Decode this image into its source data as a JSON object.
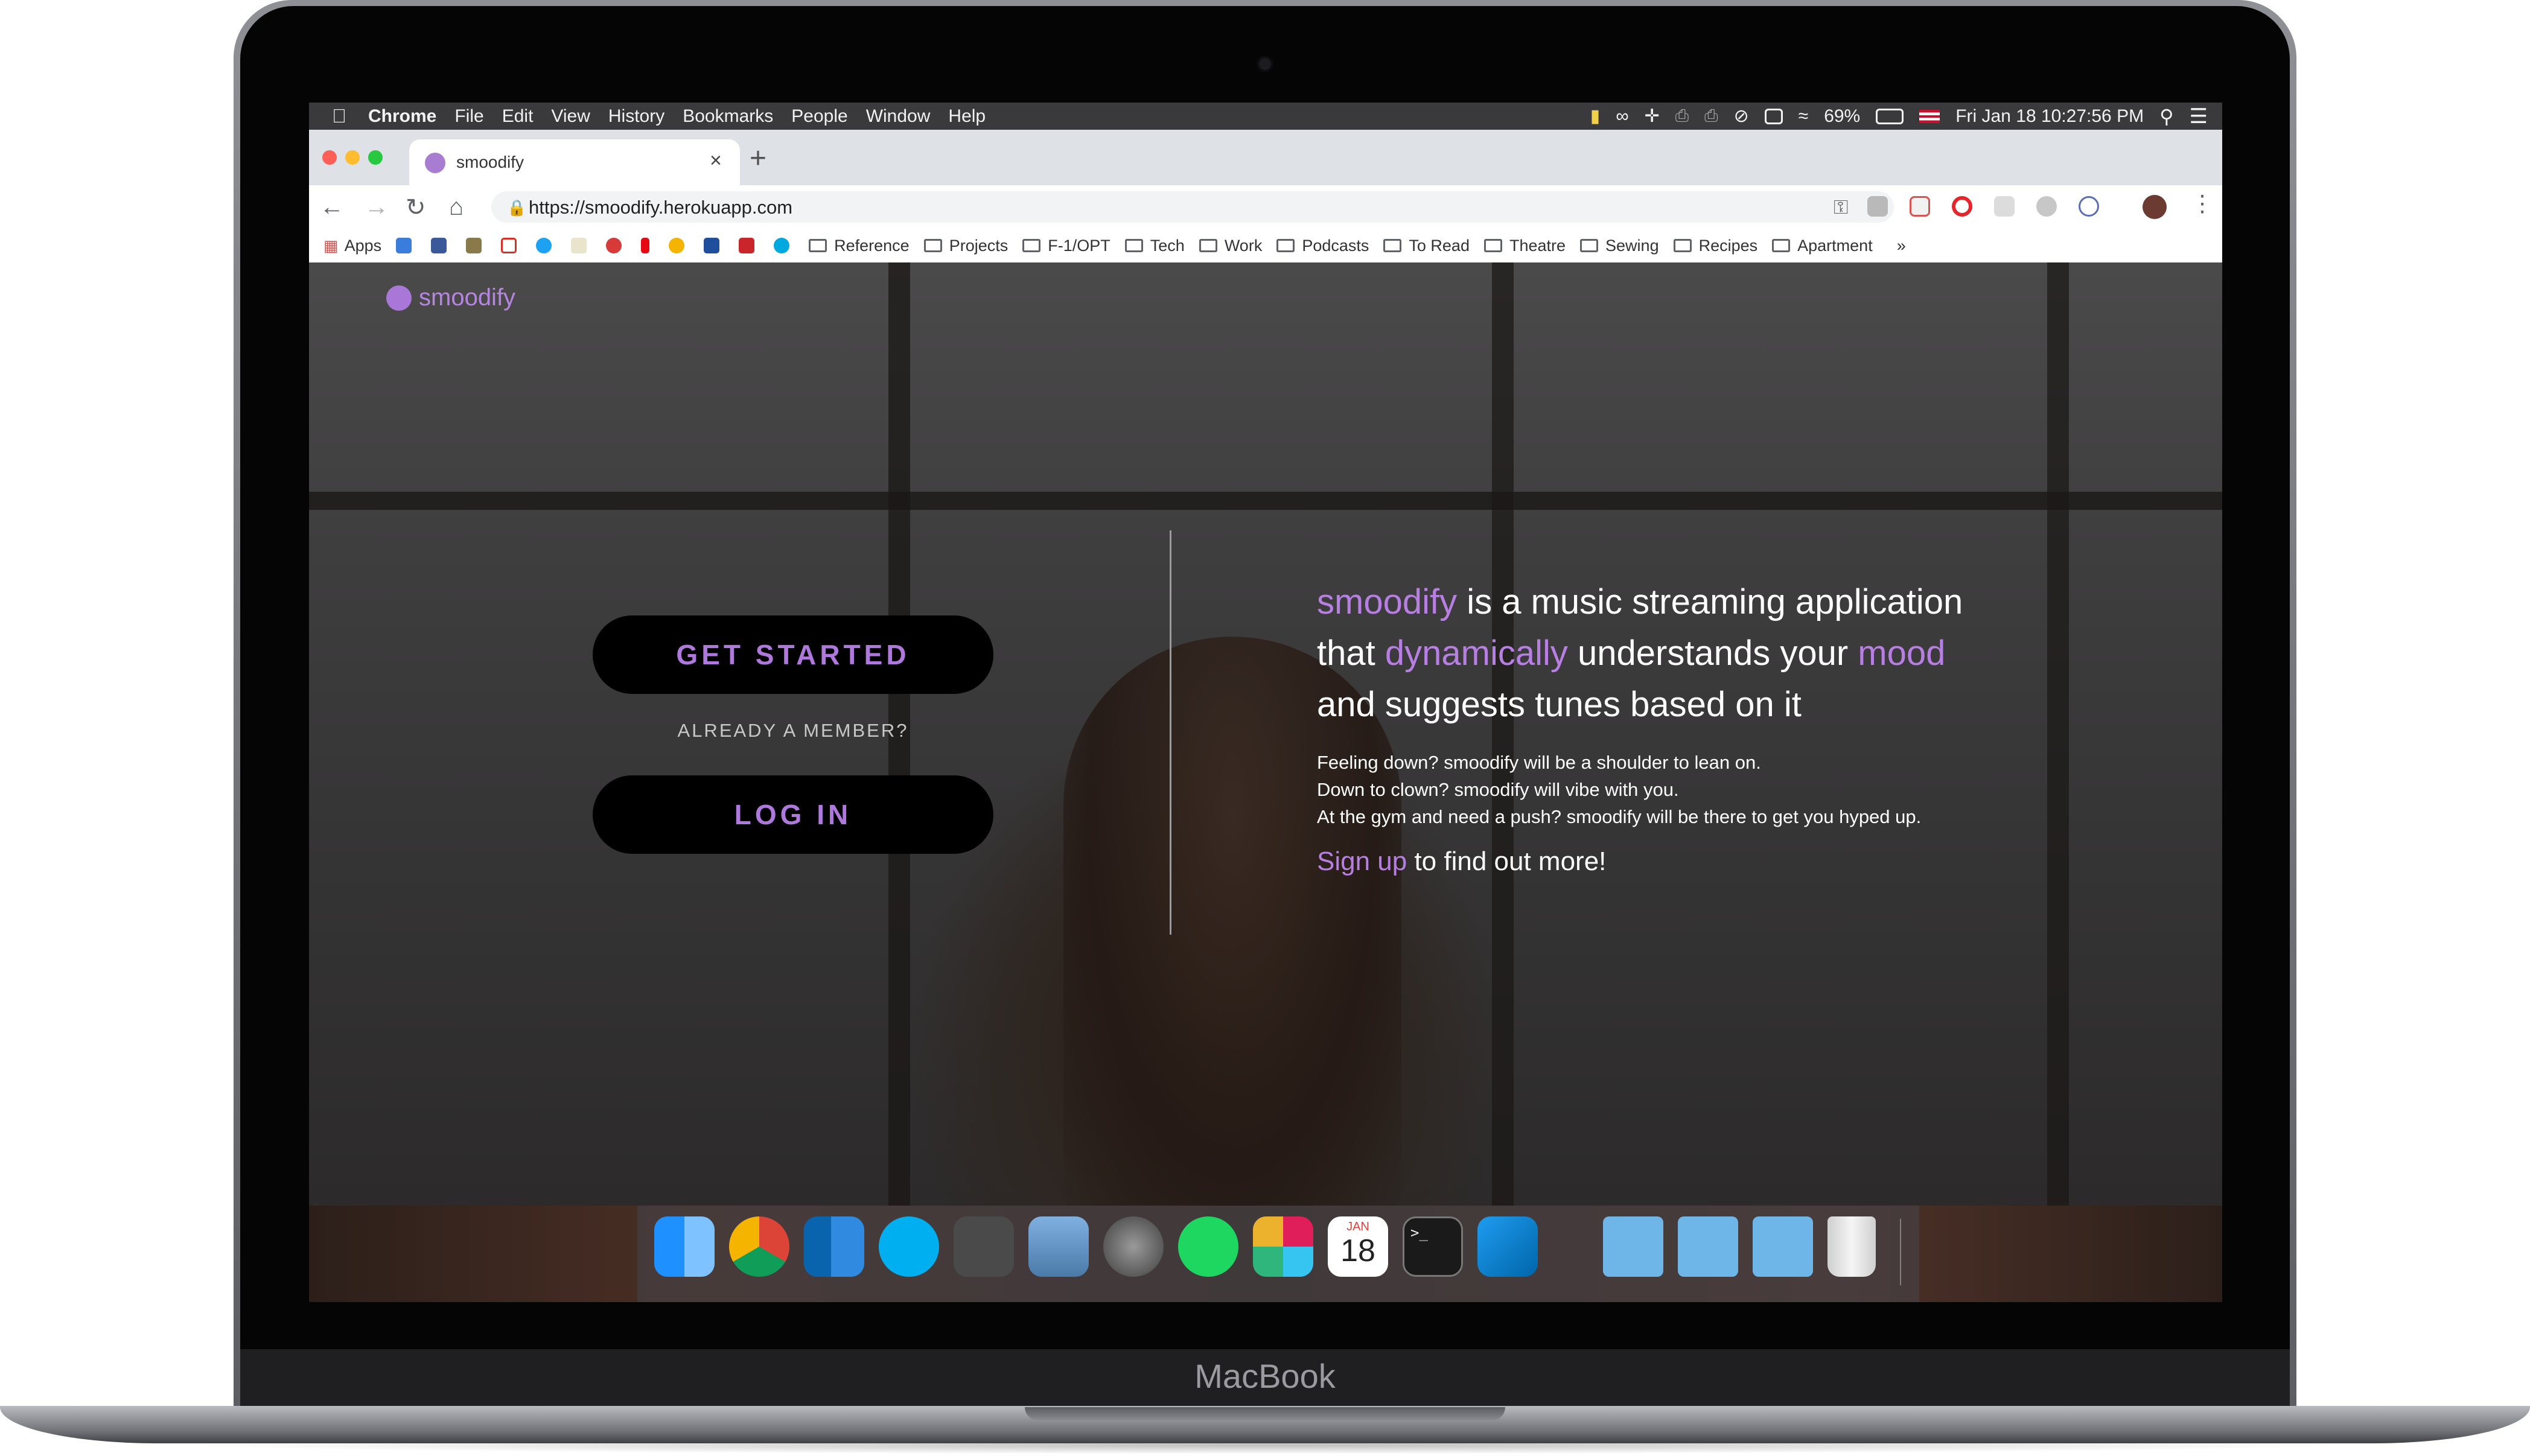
{
  "device": {
    "label": "MacBook"
  },
  "menubar": {
    "apple_icon": "apple-icon",
    "items": [
      "Chrome",
      "File",
      "Edit",
      "View",
      "History",
      "Bookmarks",
      "People",
      "Window",
      "Help"
    ],
    "battery": "69%",
    "datetime": "Fri Jan 18  10:27:56 PM"
  },
  "browser": {
    "tab_title": "smoodify",
    "new_tab": "+",
    "close_tab": "×",
    "url": "https://smoodify.herokuapp.com",
    "bookmarks": {
      "apps": "Apps",
      "folders": [
        "Reference",
        "Projects",
        "F-1/OPT",
        "Tech",
        "Work",
        "Podcasts",
        "To Read",
        "Theatre",
        "Sewing",
        "Recipes",
        "Apartment"
      ],
      "overflow": "»"
    }
  },
  "page": {
    "logo": "smoodify",
    "get_started": "GET STARTED",
    "already_member": "ALREADY A MEMBER?",
    "login": "LOG IN",
    "headline": {
      "w1": "smoodify",
      "t1": " is a music streaming application",
      "t2": "that ",
      "w2": "dynamically",
      "t3": " understands your ",
      "w3": "mood",
      "t4": "and suggests tunes based on it"
    },
    "blurb": [
      "Feeling down? smoodify will be a shoulder to lean on.",
      "Down to clown? smoodify will vibe with you.",
      "At the gym and need a push? smoodify will be there to get you hyped up."
    ],
    "signup_link": "Sign up",
    "signup_rest": " to find out more!"
  },
  "dock": {
    "calendar_month": "JAN",
    "calendar_day": "18",
    "terminal_prompt": ">_"
  },
  "colors": {
    "accent": "#b77fe2",
    "button_bg": "#000000"
  }
}
